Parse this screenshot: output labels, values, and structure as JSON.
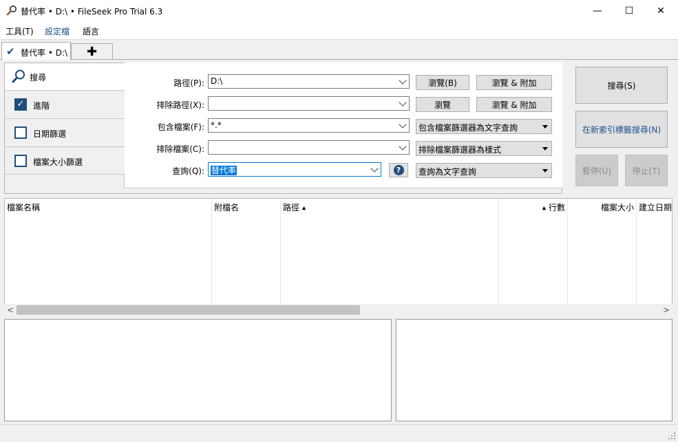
{
  "window": {
    "title": "替代率 • D:\\ • FileSeek Pro Trial 6.3",
    "minimize_glyph": "—",
    "maximize_glyph": "☐",
    "close_glyph": "✕"
  },
  "menu": {
    "tools": "工具(T)",
    "profiles": "設定檔",
    "language": "語言"
  },
  "tabs": {
    "active_label": "替代率 • D:\\",
    "add_glyph": "✚"
  },
  "sidebar": {
    "search": "搜尋",
    "advanced": "進階",
    "advanced_checked": true,
    "date_filter": "日期篩選",
    "date_filter_checked": false,
    "size_filter": "檔案大小篩選",
    "size_filter_checked": false
  },
  "form": {
    "path_label": "路徑(P):",
    "path_value": "D:\\",
    "browse_button": "瀏覽(B)",
    "browse_append_button": "瀏覽 & 附加",
    "exclude_path_label": "排除路徑(X):",
    "exclude_path_value": "",
    "exclude_browse_button": "瀏覽",
    "exclude_browse_append_button": "瀏覽 & 附加",
    "include_files_label": "包含檔案(F):",
    "include_files_value": "*.*",
    "include_files_mode": "包含檔案篩選器為文字查詢",
    "exclude_files_label": "排除檔案(C):",
    "exclude_files_value": "",
    "exclude_files_mode": "排除檔案篩選器為樣式",
    "query_label": "查詢(Q):",
    "query_value": "替代率",
    "query_mode": "查詢為文字查詢",
    "help_glyph": "?"
  },
  "actions": {
    "search": "搜尋(S)",
    "index_search": "在新索引標籤搜尋(N)",
    "pause": "暫停(U)",
    "stop": "停止(T)"
  },
  "results": {
    "columns": [
      "檔案名稱",
      "附檔名",
      "路徑",
      "行數",
      "檔案大小",
      "建立日期"
    ],
    "rows": []
  },
  "colors": {
    "accent": "#1f4e79",
    "link": "#1c4f8d",
    "selection": "#0078d7"
  }
}
